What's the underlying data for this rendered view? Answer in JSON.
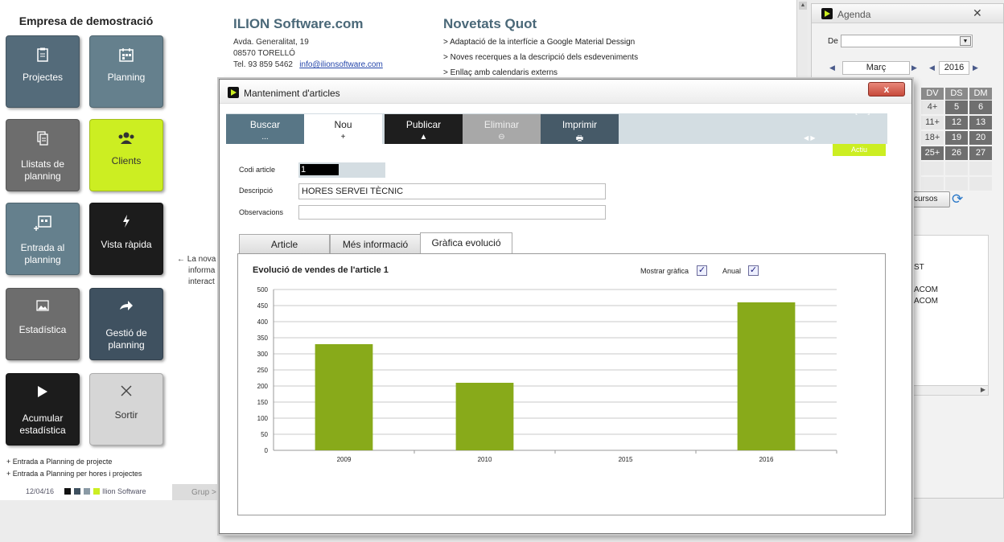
{
  "sidebar": {
    "company": "Empresa de demostració",
    "tiles": [
      {
        "label": "Projectes",
        "icon": "clipboard-icon"
      },
      {
        "label": "Planning",
        "icon": "calendar-icon"
      },
      {
        "label": "Llistats de planning",
        "icon": "documents-icon"
      },
      {
        "label": "Clients",
        "icon": "users-icon"
      },
      {
        "label": "Entrada al planning",
        "icon": "calendar-add-icon"
      },
      {
        "label": "Vista ràpida",
        "icon": "lightning-icon"
      },
      {
        "label": "Estadística",
        "icon": "image-icon"
      },
      {
        "label": "Gestió de planning",
        "icon": "share-arrow-icon"
      },
      {
        "label": "Acumular estadística",
        "icon": "play-icon"
      },
      {
        "label": "Sortir",
        "icon": "close-icon"
      }
    ],
    "quick_links": [
      "+ Entrada a Planning de projecte",
      "+ Entrada a Planning per hores i projectes"
    ],
    "footer_date": "12/04/16",
    "footer_brand": "Ilion Software",
    "footer_colors": [
      "#111111",
      "#3f5160",
      "#8a9aa5",
      "#ccee22"
    ]
  },
  "background": {
    "company_title": "ILION Software.com",
    "address": "Avda. Generalitat, 19",
    "city": "08570 TORELLÓ",
    "phone": "Tel. 93 859 5462",
    "email": "info@ilionsoftware.com",
    "news_title": "Novetats Quot",
    "news": [
      "> Adaptació de la interfície a Google Material Dessign",
      "> Noves recerques a la descripció dels esdeveniments",
      "> Enllaç amb calendaris externs"
    ],
    "side_text": [
      "← La nova",
      "informa",
      "interact"
    ],
    "grup": "Grup >"
  },
  "agenda": {
    "title": "Agenda",
    "de_label": "De",
    "month": "Març",
    "year": "2016",
    "day_headers": [
      "DV",
      "DS",
      "DM"
    ],
    "rows": [
      [
        "4+",
        "5",
        "6"
      ],
      [
        "11+",
        "12",
        "13"
      ],
      [
        "18+",
        "19",
        "20"
      ],
      [
        "25+",
        "26",
        "27"
      ]
    ],
    "recursos_btn": "cursos",
    "list_items": [
      "ST",
      "ACOM",
      "ACOM"
    ]
  },
  "window": {
    "title": "Manteniment d'articles",
    "close_label": "x",
    "ifis": "[Ifis]",
    "toolbar": [
      {
        "label": "Buscar",
        "sub": "..."
      },
      {
        "label": "Nou",
        "sub": "+"
      },
      {
        "label": "Publicar",
        "sub": "▲"
      },
      {
        "label": "Eliminar",
        "sub": "⊖"
      },
      {
        "label": "Imprimir",
        "sub": "🖶"
      }
    ],
    "nav_arrows": "◀  ▶",
    "status": "Actiu",
    "fields": {
      "codi_label": "Codi article",
      "codi_value": "1",
      "desc_label": "Descripció",
      "desc_value": "HORES SERVEI TÈCNIC",
      "obs_label": "Observacions",
      "obs_value": ""
    },
    "tabs": [
      "Article",
      "Més informació",
      "Gràfica evolució"
    ],
    "active_tab": "Gràfica evolució",
    "chart_heading": "Evolució de vendes de l'article  1",
    "show_chart_label": "Mostrar gràfica",
    "show_chart_checked": true,
    "annual_label": "Anual",
    "annual_checked": true
  },
  "chart_data": {
    "type": "bar",
    "categories": [
      "2009",
      "2010",
      "2015",
      "2016"
    ],
    "values": [
      330,
      210,
      0,
      460
    ],
    "ylim": [
      0,
      500
    ],
    "yticks": [
      0,
      50,
      100,
      150,
      200,
      250,
      300,
      350,
      400,
      450,
      500
    ],
    "grid": true,
    "bar_color": "#88aa1a"
  }
}
